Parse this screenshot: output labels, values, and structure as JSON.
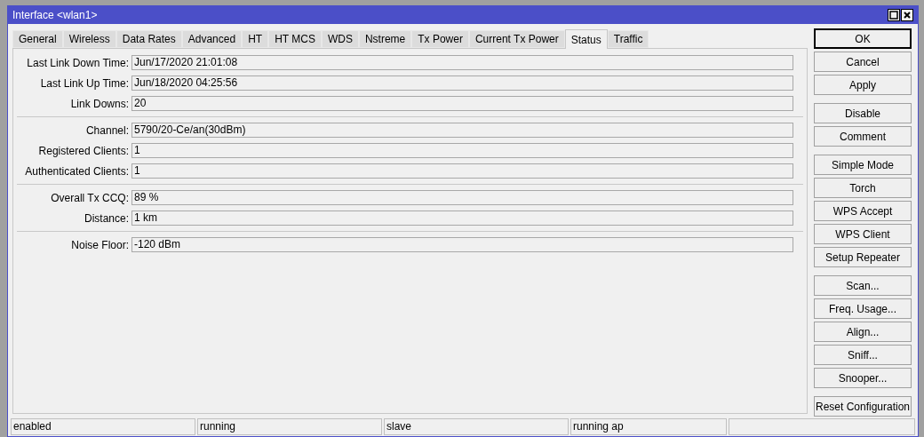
{
  "window": {
    "title": "Interface <wlan1>"
  },
  "tabs": [
    {
      "label": "General",
      "selected": false
    },
    {
      "label": "Wireless",
      "selected": false
    },
    {
      "label": "Data Rates",
      "selected": false
    },
    {
      "label": "Advanced",
      "selected": false
    },
    {
      "label": "HT",
      "selected": false
    },
    {
      "label": "HT MCS",
      "selected": false
    },
    {
      "label": "WDS",
      "selected": false
    },
    {
      "label": "Nstreme",
      "selected": false
    },
    {
      "label": "Tx Power",
      "selected": false
    },
    {
      "label": "Current Tx Power",
      "selected": false
    },
    {
      "label": "Status",
      "selected": true
    },
    {
      "label": "Traffic",
      "selected": false
    }
  ],
  "field_groups": [
    [
      {
        "label": "Last Link Down Time:",
        "value": "Jun/17/2020 21:01:08"
      },
      {
        "label": "Last Link Up Time:",
        "value": "Jun/18/2020 04:25:56"
      },
      {
        "label": "Link Downs:",
        "value": "20"
      }
    ],
    [
      {
        "label": "Channel:",
        "value": "5790/20-Ce/an(30dBm)"
      },
      {
        "label": "Registered Clients:",
        "value": "1"
      },
      {
        "label": "Authenticated Clients:",
        "value": "1"
      }
    ],
    [
      {
        "label": "Overall Tx CCQ:",
        "value": "89 %"
      },
      {
        "label": "Distance:",
        "value": "1 km"
      }
    ],
    [
      {
        "label": "Noise Floor:",
        "value": "-120 dBm"
      }
    ]
  ],
  "button_groups": [
    [
      {
        "label": "OK",
        "default": true
      },
      {
        "label": "Cancel",
        "default": false
      },
      {
        "label": "Apply",
        "default": false
      }
    ],
    [
      {
        "label": "Disable",
        "default": false
      },
      {
        "label": "Comment",
        "default": false
      }
    ],
    [
      {
        "label": "Simple Mode",
        "default": false
      },
      {
        "label": "Torch",
        "default": false
      },
      {
        "label": "WPS Accept",
        "default": false
      },
      {
        "label": "WPS Client",
        "default": false
      },
      {
        "label": "Setup Repeater",
        "default": false
      }
    ],
    [
      {
        "label": "Scan...",
        "default": false
      },
      {
        "label": "Freq. Usage...",
        "default": false
      },
      {
        "label": "Align...",
        "default": false
      },
      {
        "label": "Sniff...",
        "default": false
      },
      {
        "label": "Snooper...",
        "default": false
      }
    ],
    [
      {
        "label": "Reset Configuration",
        "default": false
      }
    ]
  ],
  "status_bar": [
    "enabled",
    "running",
    "slave",
    "running ap"
  ]
}
